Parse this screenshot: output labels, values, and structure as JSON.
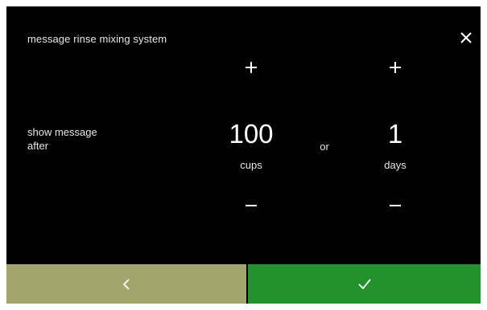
{
  "header": {
    "title": "message rinse mixing system"
  },
  "setting": {
    "label_line1": "show message",
    "label_line2": "after",
    "separator": "or",
    "cups": {
      "value": "100",
      "unit": "cups"
    },
    "days": {
      "value": "1",
      "unit": "days"
    }
  },
  "icons": {
    "close": "close-icon",
    "increase": "plus-icon",
    "decrease": "minus-icon",
    "back": "chevron-left-icon",
    "confirm": "checkmark-icon"
  },
  "colors": {
    "screen_background": "#000000",
    "back_button": "#a3a46e",
    "confirm_button": "#23922d",
    "text": "#ffffff"
  }
}
